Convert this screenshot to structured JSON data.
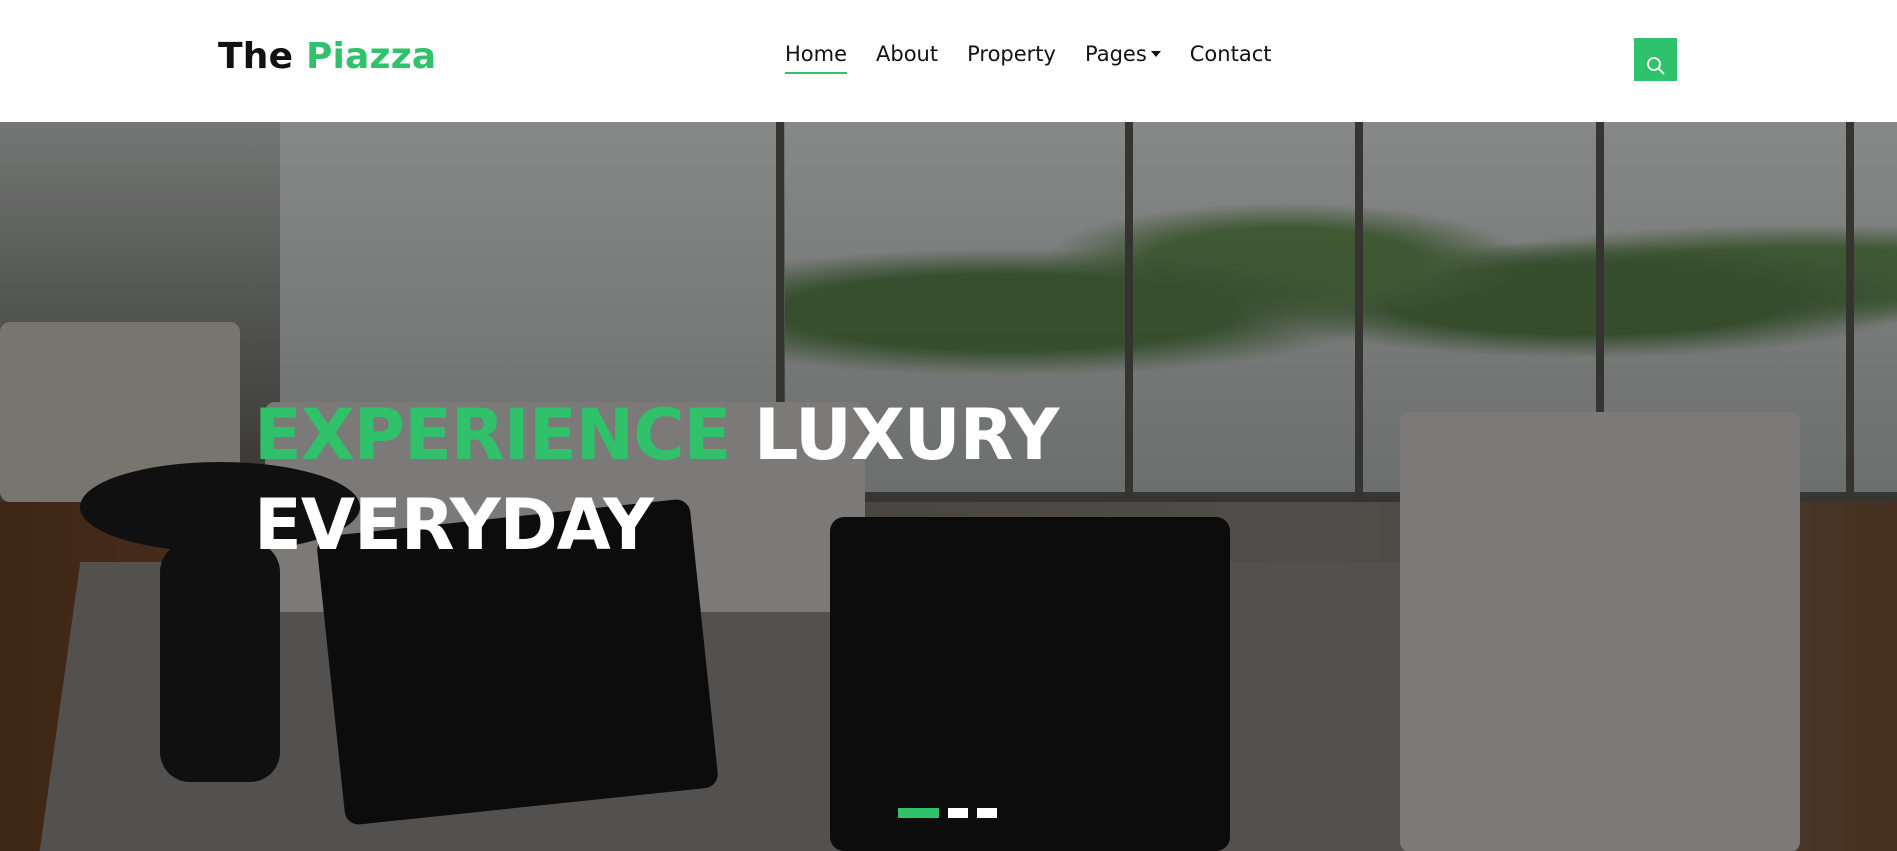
{
  "brand": {
    "part1": "The",
    "part2": "Piazza"
  },
  "nav": {
    "items": [
      {
        "label": "Home",
        "active": true
      },
      {
        "label": "About",
        "active": false
      },
      {
        "label": "Property",
        "active": false
      },
      {
        "label": "Pages",
        "active": false,
        "has_dropdown": true
      },
      {
        "label": "Contact",
        "active": false
      }
    ],
    "search_icon": "search-icon"
  },
  "hero": {
    "title_accent": "EXPERIENCE",
    "title_rest_line1": "LUXURY",
    "title_line2": "EVERYDAY",
    "slides": 3,
    "active_slide": 1
  },
  "colors": {
    "accent": "#2fc26b",
    "text": "#111111",
    "hero_text": "#ffffff"
  }
}
